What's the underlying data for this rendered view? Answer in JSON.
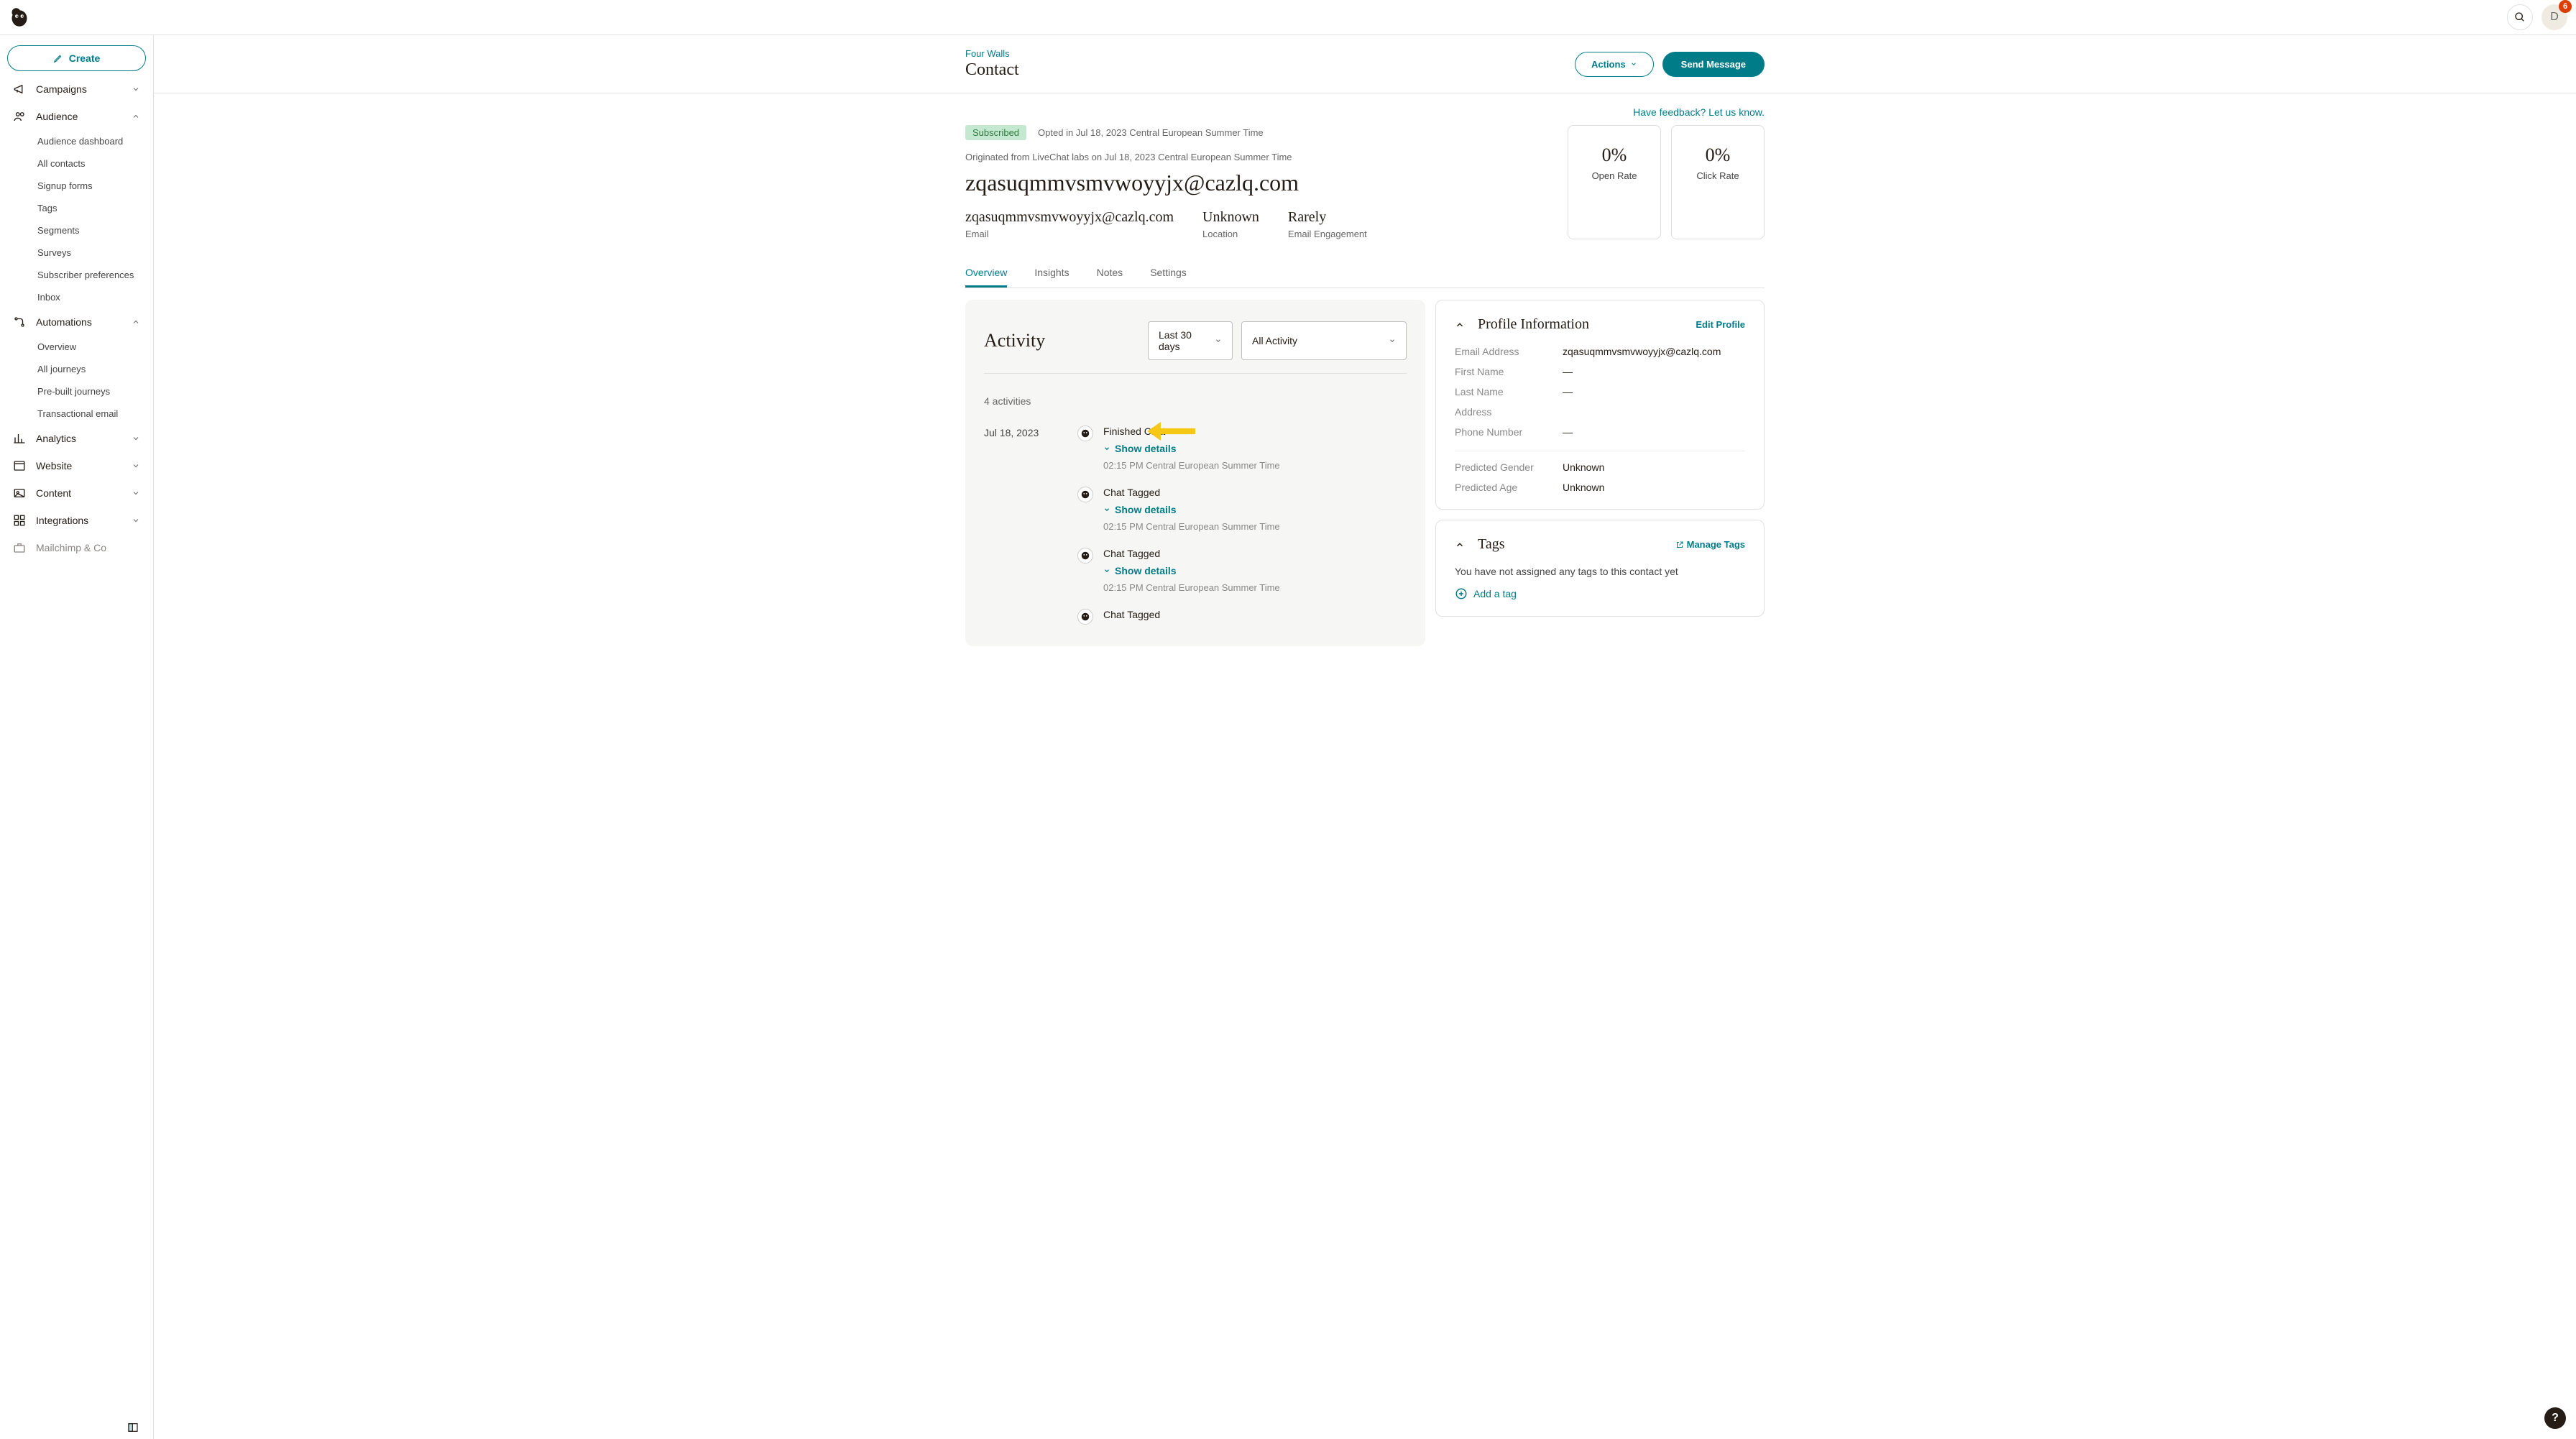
{
  "top": {
    "avatar_initial": "D",
    "notification_count": "6"
  },
  "sidebar": {
    "create_label": "Create",
    "nav": {
      "campaigns": "Campaigns",
      "audience": "Audience",
      "automations": "Automations",
      "analytics": "Analytics",
      "website": "Website",
      "content": "Content",
      "integrations": "Integrations",
      "mailchimp_co": "Mailchimp & Co"
    },
    "audience_items": [
      "Audience dashboard",
      "All contacts",
      "Signup forms",
      "Tags",
      "Segments",
      "Surveys",
      "Subscriber preferences",
      "Inbox"
    ],
    "automations_items": [
      "Overview",
      "All journeys",
      "Pre-built journeys",
      "Transactional email"
    ]
  },
  "header": {
    "breadcrumb": "Four Walls",
    "title": "Contact",
    "actions_btn": "Actions",
    "send_btn": "Send Message"
  },
  "feedback_link": "Have feedback? Let us know.",
  "contact": {
    "status_badge": "Subscribed",
    "opted": "Opted in Jul 18, 2023 Central European Summer Time",
    "originated": "Originated from LiveChat labs on Jul 18, 2023 Central European Summer Time",
    "email_big": "zqasuqmmvsmvwoyyjx@cazlq.com",
    "meta": {
      "email": {
        "val": "zqasuqmmvsmvwoyyjx@cazlq.com",
        "lbl": "Email"
      },
      "location": {
        "val": "Unknown",
        "lbl": "Location"
      },
      "engagement": {
        "val": "Rarely",
        "lbl": "Email Engagement"
      }
    },
    "stats": {
      "open": {
        "val": "0%",
        "lbl": "Open Rate"
      },
      "click": {
        "val": "0%",
        "lbl": "Click Rate"
      }
    }
  },
  "tabs": [
    "Overview",
    "Insights",
    "Notes",
    "Settings"
  ],
  "activity": {
    "heading": "Activity",
    "filter_range": "Last 30 days",
    "filter_type": "All Activity",
    "count_label": "4 activities",
    "date": "Jul 18, 2023",
    "show_details": "Show details",
    "events": [
      {
        "title": "Finished Chat",
        "time": "02:15 PM Central European Summer Time",
        "highlight": true
      },
      {
        "title": "Chat Tagged",
        "time": "02:15 PM Central European Summer Time"
      },
      {
        "title": "Chat Tagged",
        "time": "02:15 PM Central European Summer Time"
      },
      {
        "title": "Chat Tagged",
        "time": ""
      }
    ]
  },
  "profile": {
    "heading": "Profile Information",
    "edit": "Edit Profile",
    "rows1": [
      {
        "k": "Email Address",
        "v": "zqasuqmmvsmvwoyyjx@cazlq.com"
      },
      {
        "k": "First Name",
        "v": "—"
      },
      {
        "k": "Last Name",
        "v": "—"
      },
      {
        "k": "Address",
        "v": ""
      },
      {
        "k": "Phone Number",
        "v": "—"
      }
    ],
    "rows2": [
      {
        "k": "Predicted Gender",
        "v": "Unknown"
      },
      {
        "k": "Predicted Age",
        "v": "Unknown"
      }
    ]
  },
  "tags_card": {
    "heading": "Tags",
    "manage": "Manage Tags",
    "empty": "You have not assigned any tags to this contact yet",
    "add": "Add a tag"
  }
}
